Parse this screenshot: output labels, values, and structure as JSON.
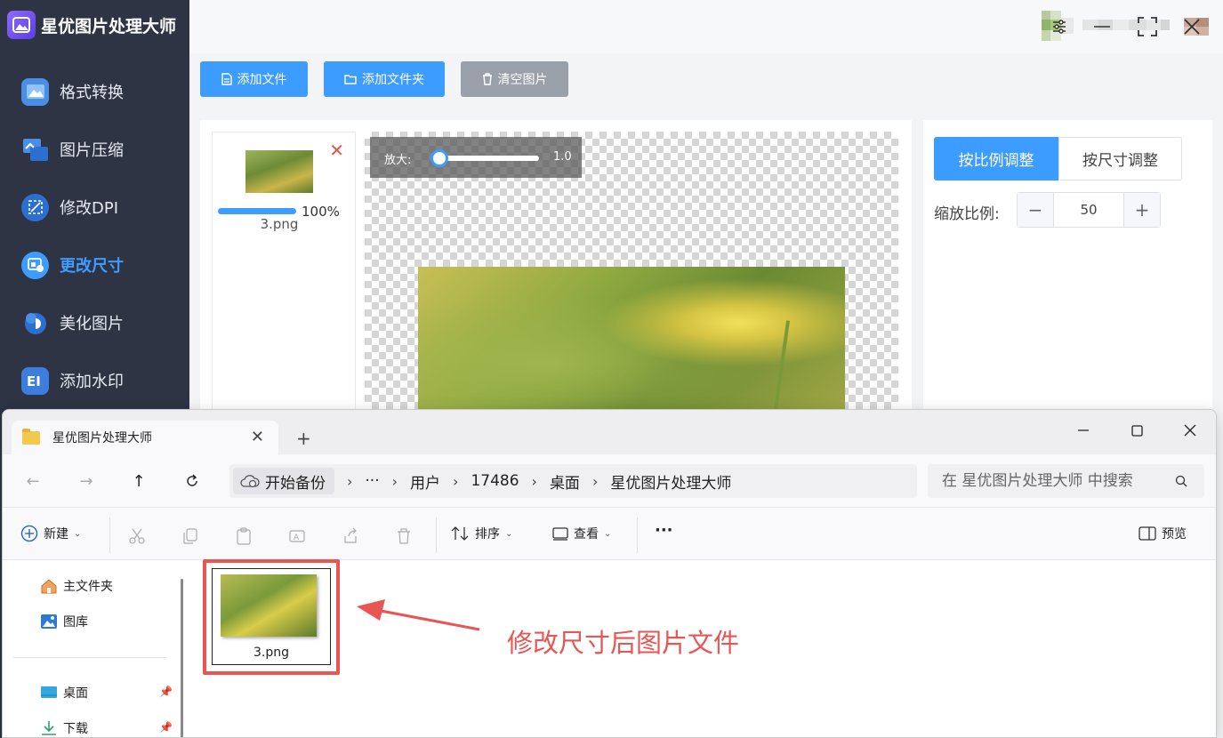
{
  "app": {
    "title": "星优图片处理大师",
    "nav": [
      {
        "label": "格式转换",
        "icon": "image-convert-icon",
        "active": false
      },
      {
        "label": "图片压缩",
        "icon": "compress-icon",
        "active": false
      },
      {
        "label": "修改DPI",
        "icon": "dpi-icon",
        "active": false
      },
      {
        "label": "更改尺寸",
        "icon": "resize-icon",
        "active": true
      },
      {
        "label": "美化图片",
        "icon": "beautify-icon",
        "active": false
      },
      {
        "label": "添加水印",
        "icon": "watermark-icon",
        "active": false
      }
    ],
    "toolbar": {
      "add_file": "添加文件",
      "add_folder": "添加文件夹",
      "clear": "清空图片"
    },
    "file": {
      "progress_text": "100%",
      "progress": 1.0,
      "name": "3.png"
    },
    "zoom": {
      "label": "放大:",
      "value": "1.0",
      "level": 0.0
    },
    "settings": {
      "tab_ratio": "按比例调整",
      "tab_size": "按尺寸调整",
      "scale_label": "缩放比例:",
      "scale_value": "50",
      "minus": "−",
      "plus": "+"
    },
    "accent_color": "#3d9cff"
  },
  "explorer": {
    "tab_title": "星优图片处理大师",
    "breadcrumb_first": "开始备份",
    "breadcrumb_more": "···",
    "breadcrumbs": [
      "用户",
      "17486",
      "桌面",
      "星优图片处理大师"
    ],
    "search_placeholder": "在 星优图片处理大师 中搜索",
    "toolbar": {
      "new": "新建",
      "sort": "排序",
      "view": "查看",
      "more": "···",
      "preview": "预览"
    },
    "sidebar": [
      {
        "label": "主文件夹",
        "icon": "home-icon"
      },
      {
        "label": "图库",
        "icon": "gallery-icon"
      },
      {
        "label": "桌面",
        "icon": "desktop-icon",
        "pinned": true
      },
      {
        "label": "下载",
        "icon": "download-icon",
        "pinned": true
      }
    ],
    "file": {
      "name": "3.png"
    }
  },
  "annotation": {
    "text": "修改尺寸后图片文件",
    "color": "#e85553"
  }
}
